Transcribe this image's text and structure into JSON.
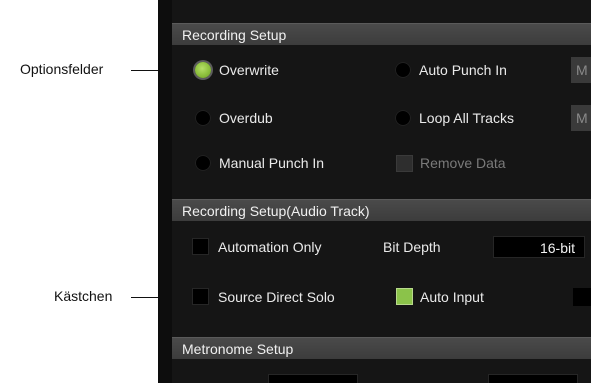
{
  "callouts": {
    "radio": "Optionsfelder",
    "checkbox": "Kästchen"
  },
  "recording_setup": {
    "title": "Recording Setup",
    "overwrite": "Overwrite",
    "auto_punch_in": "Auto Punch In",
    "overdub": "Overdub",
    "loop_all_tracks": "Loop All Tracks",
    "manual_punch_in": "Manual Punch In",
    "remove_data": "Remove Data",
    "stub_1": "M",
    "stub_2": "M",
    "selected": "Overwrite"
  },
  "audio_track": {
    "title": "Recording Setup(Audio Track)",
    "automation_only": "Automation Only",
    "bit_depth_label": "Bit Depth",
    "bit_depth_value": "16-bit",
    "source_direct_solo": "Source Direct Solo",
    "auto_input": "Auto Input",
    "auto_input_checked": true
  },
  "metronome": {
    "title": "Metronome Setup"
  },
  "colors": {
    "accent_green": "#8bc34a",
    "section_header": "#444444",
    "panel_bg": "#151515"
  }
}
